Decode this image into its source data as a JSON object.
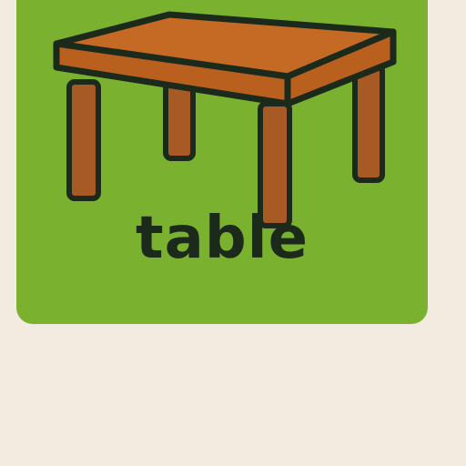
{
  "card": {
    "word": "table",
    "icon": "table-icon"
  },
  "colors": {
    "page_background": "#f3ebdf",
    "card_background": "#7ab22f",
    "table_top": "#c56a25",
    "table_top_side": "#b9601f",
    "table_legs": "#a85a25",
    "outline": "#1b2a1b",
    "word_text": "#1b2a1b"
  }
}
